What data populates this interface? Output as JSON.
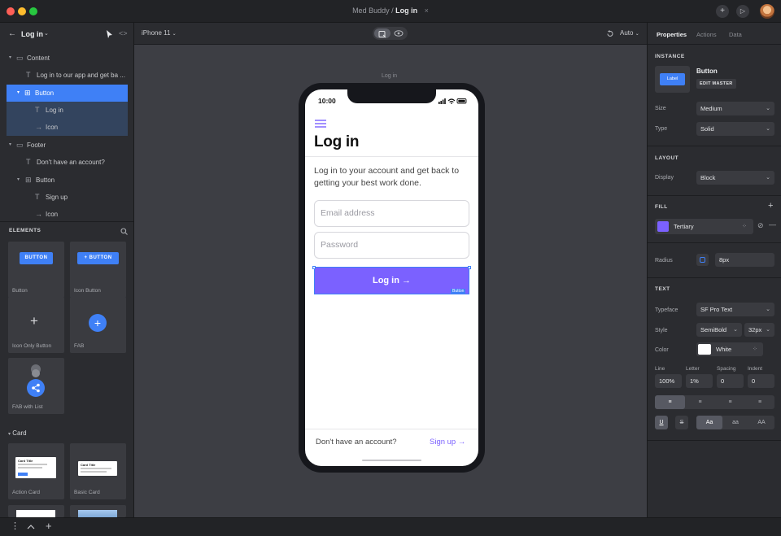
{
  "window": {
    "project": "Med Buddy",
    "separator": "/",
    "screen": "Log in",
    "close_glyph": "×",
    "add_glyph": "+",
    "play_glyph": "▷"
  },
  "left": {
    "back_glyph": "←",
    "screen_title": "Log in",
    "tree": [
      {
        "icon": "▭",
        "label": "Content"
      },
      {
        "icon": "T",
        "label": "Log in to our app and get ba ..."
      },
      {
        "icon": "⊞",
        "label": "Button"
      },
      {
        "icon": "T",
        "label": "Log in"
      },
      {
        "icon": "→",
        "label": "Icon"
      },
      {
        "icon": "▭",
        "label": "Footer"
      },
      {
        "icon": "T",
        "label": "Don't have an account?"
      },
      {
        "icon": "⊞",
        "label": "Button"
      },
      {
        "icon": "T",
        "label": "Sign up"
      },
      {
        "icon": "→",
        "label": "Icon"
      }
    ],
    "elements_title": "ELEMENTS",
    "elements": [
      {
        "label": "Button",
        "preview": "BUTTON"
      },
      {
        "label": "Icon Button",
        "preview": "+ BUTTON"
      },
      {
        "label": "Icon Only Button",
        "preview": "+"
      },
      {
        "label": "FAB",
        "preview": "+"
      },
      {
        "label": "FAB with List",
        "preview": ""
      }
    ],
    "card_section": "Card",
    "cards": [
      {
        "label": "Action Card",
        "preview_title": "Card Title"
      },
      {
        "label": "Basic Card",
        "preview_title": "Card Title"
      }
    ]
  },
  "canvas": {
    "device": "iPhone 11",
    "zoom": "Auto",
    "frame_label": "Log in",
    "phone": {
      "time": "10:00",
      "heading": "Log in",
      "subtitle": "Log in to your account and get back to getting your best work done.",
      "email_placeholder": "Email address",
      "password_placeholder": "Password",
      "login_button": "Log in →",
      "selection_tag": "Button",
      "footer_text": "Don't have an account?",
      "signup_link": "Sign up →"
    }
  },
  "right": {
    "tabs": [
      "Properties",
      "Actions",
      "Data"
    ],
    "instance_title": "INSTANCE",
    "instance_preview": "Label",
    "instance_name": "Button",
    "edit_master": "EDIT MASTER",
    "size_label": "Size",
    "size_value": "Medium",
    "type_label": "Type",
    "type_value": "Solid",
    "layout_title": "LAYOUT",
    "display_label": "Display",
    "display_value": "Block",
    "fill_title": "FILL",
    "fill_name": "Tertiary",
    "fill_color": "#7b61ff",
    "radius_label": "Radius",
    "radius_value": "8px",
    "text_title": "TEXT",
    "typeface_label": "Typeface",
    "typeface_value": "SF Pro Text",
    "style_label": "Style",
    "style_value": "SemiBold",
    "size_px": "32px",
    "color_label": "Color",
    "color_value": "White",
    "metrics": [
      {
        "label": "Line",
        "value": "100%"
      },
      {
        "label": "Letter",
        "value": "1%"
      },
      {
        "label": "Spacing",
        "value": "0"
      },
      {
        "label": "Indent",
        "value": "0"
      }
    ],
    "case_options": [
      "Aa",
      "aa",
      "AA"
    ],
    "underline": "U",
    "strike": "S"
  },
  "colors": {
    "accent": "#3f80f6",
    "purple": "#7b61ff"
  }
}
